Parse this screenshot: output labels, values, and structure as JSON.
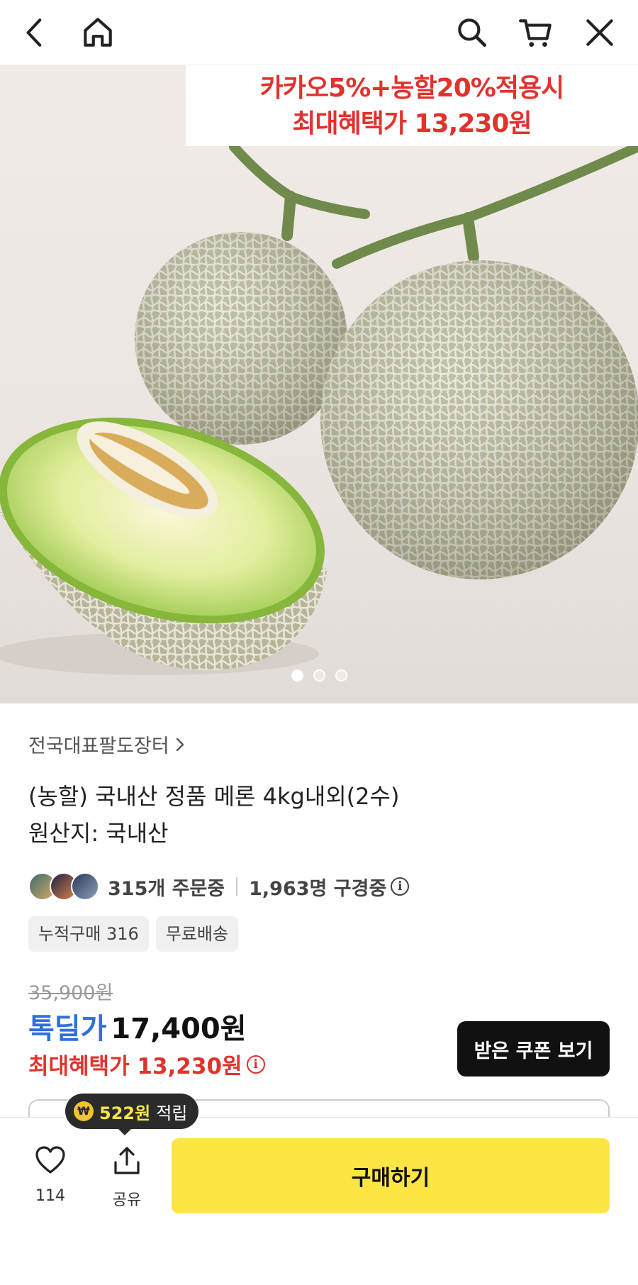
{
  "nav": {
    "back_icon": "chevron-left-icon",
    "home_icon": "home-icon",
    "search_icon": "search-icon",
    "cart_icon": "cart-icon",
    "close_icon": "close-icon"
  },
  "hero": {
    "promo_line1": "카카오5%+농할20%적용시",
    "promo_line2": "최대혜택가 13,230원",
    "carousel_total": 3,
    "carousel_active": 1
  },
  "product": {
    "seller": "전국대표팔도장터",
    "title": "(농할) 국내산 정품 메론 4kg내외(2수)",
    "origin": "원산지: 국내산",
    "orders": "315개 주문중",
    "viewers": "1,963명 구경중",
    "tags": [
      "누적구매 316",
      "무료배송"
    ],
    "original_price": "35,900원",
    "deal_label": "톡딜가",
    "deal_price": "17,400원",
    "max_benefit": "최대혜택가 13,230원",
    "coupon_button": "받은 쿠폰 보기"
  },
  "tooltip": {
    "coin_symbol": "₩",
    "amount": "522원",
    "text": "적립"
  },
  "bottom": {
    "like_count": "114",
    "share_label": "공유",
    "buy_button": "구매하기"
  },
  "colors": {
    "promo_red": "#e2322c",
    "deal_blue": "#2f6fe0",
    "buy_yellow": "#fde543",
    "coupon_black": "#111111"
  }
}
